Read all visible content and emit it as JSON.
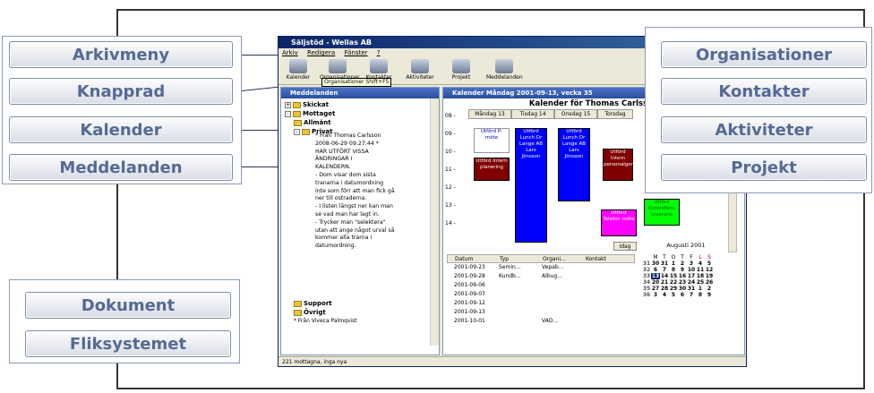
{
  "buttons_left": [
    "Arkivmeny",
    "Knapprad",
    "Kalender",
    "Meddelanden"
  ],
  "buttons_right": [
    "Organisationer",
    "Kontakter",
    "Aktiviteter",
    "Projekt"
  ],
  "buttons_bottom": [
    "Dokument",
    "Fliksystemet"
  ],
  "window": {
    "title": "Säljstöd - Wellas AB",
    "menu": [
      "Arkiv",
      "Redigera",
      "Fönster",
      "?"
    ],
    "toolbar": [
      "Kalender",
      "Organisationer",
      "Kontakter",
      "Aktiviteter",
      "Projekt",
      "Meddelanden"
    ],
    "tooltip": "Organisationer Shift+F5",
    "status": "221 mottagna, inga nya"
  },
  "messages_pane": {
    "title": "Meddelanden",
    "tree": [
      "Skickat",
      "Mottaget",
      "Allmänt",
      "Privat"
    ],
    "message_lines": [
      "* Från Thomas Carlsson",
      "2008-06-29 09:27:44 *",
      "HAR UTFÖRT VISSA",
      "ÄNDRINGAR I",
      "KALENDERN.",
      "- Dom visar dom sista",
      "tranarna i datumordning",
      "inte som förr att man fick gå",
      "ner till ostraderna.",
      "- I listen längst ner kan man",
      "se vad man har lagt in.",
      "- Trycker man \"selektera\"",
      "utan att ange något urval så",
      "kommer alla trarna i",
      "datumordning."
    ],
    "more_tree": [
      "Support",
      "Övrigt"
    ],
    "last_line": "* Från Viveca Palmqvist"
  },
  "calendar_pane": {
    "header": "Kalender Måndag 2001-09-13, vecka 35",
    "title": "Kalender för Thomas Carlsson",
    "days": [
      "Måndag 13",
      "Tisdag 14",
      "Onsdag 15",
      "Torsdag"
    ],
    "hours": [
      "08 -",
      "09 -",
      "10 -",
      "11 -",
      "12 -",
      "13 -",
      "14 -"
    ],
    "events": [
      {
        "text": "Utförd P-möte",
        "color": "#ffffff",
        "fg": "#0000c0"
      },
      {
        "text": "Utförd Intern planering",
        "color": "#800000",
        "fg": "#ffffff"
      },
      {
        "text": "Utförd Lunch Dr Lange AB Lars Jönsson",
        "color": "#0000ff",
        "fg": "#ffffff"
      },
      {
        "text": "Utförd Lunch Dr Lange AB Lars Jönsson",
        "color": "#0000ff",
        "fg": "#ffffff"
      },
      {
        "text": "Utförd Intern personalgenom",
        "color": "#800000",
        "fg": "#ffffff"
      },
      {
        "text": "Utförd Telefon möte",
        "color": "#ff00ff",
        "fg": "#ffffff"
      },
      {
        "text": "Utförd Kontrollera leverans",
        "color": "#00ff00",
        "fg": "#008000"
      }
    ],
    "idag": "Idag",
    "table_headers": [
      "Datum",
      "Typ",
      "Organi...",
      "Kontakt"
    ],
    "table_rows": [
      [
        "2001-09-23",
        "Semin...",
        "Vepab...",
        ""
      ],
      [
        "2001-09-28",
        "Kundb...",
        "Albug...",
        ""
      ],
      [
        "2001-09-06",
        "",
        "",
        ""
      ],
      [
        "2001-09-07",
        "",
        "",
        ""
      ],
      [
        "2001-09-12",
        "",
        "",
        ""
      ],
      [
        "2001-09-13",
        "",
        "",
        ""
      ],
      [
        "2001-10-01",
        "",
        "VAD...",
        ""
      ]
    ],
    "mini_cal": {
      "month": "Augusti 2001",
      "weekdays": [
        "M",
        "T",
        "O",
        "T",
        "F",
        "L",
        "S"
      ],
      "rows": [
        [
          "31",
          "30",
          "31",
          "1",
          "2",
          "3",
          "4",
          "5"
        ],
        [
          "32",
          "6",
          "7",
          "8",
          "9",
          "10",
          "11",
          "12"
        ],
        [
          "33",
          "13",
          "14",
          "15",
          "16",
          "17",
          "18",
          "19"
        ],
        [
          "34",
          "20",
          "21",
          "22",
          "23",
          "24",
          "25",
          "26"
        ],
        [
          "35",
          "27",
          "28",
          "29",
          "30",
          "31",
          "1",
          "2"
        ],
        [
          "36",
          "3",
          "4",
          "5",
          "6",
          "7",
          "8",
          "9"
        ]
      ]
    }
  }
}
